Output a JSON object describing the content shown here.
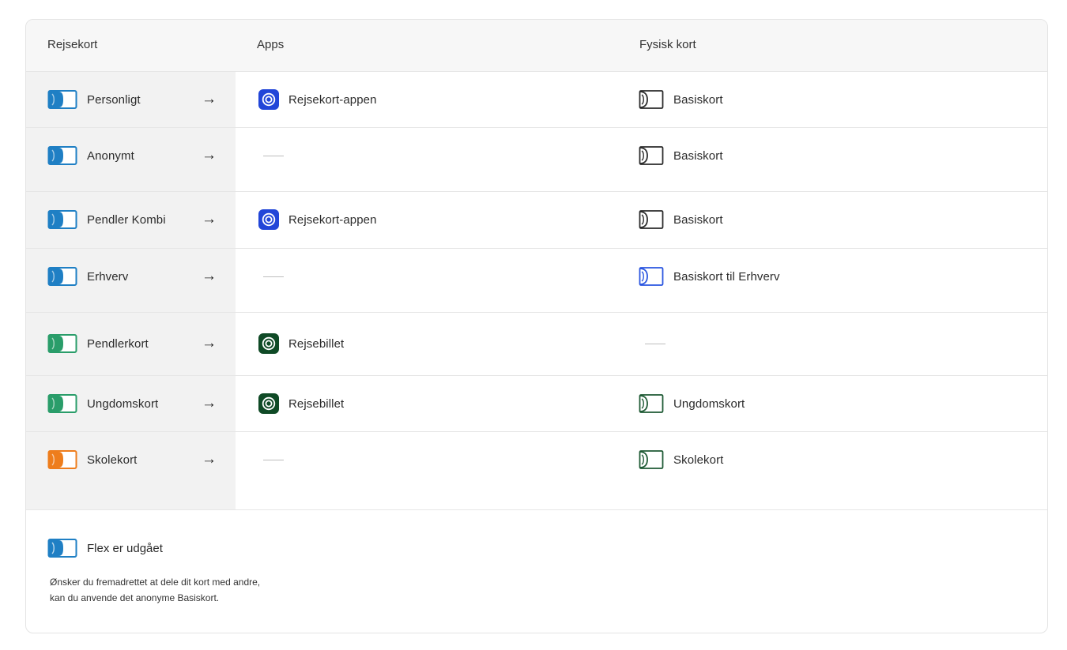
{
  "headers": {
    "col1": "Rejsekort",
    "col2": "Apps",
    "col3": "Fysisk kort"
  },
  "arrow": "→",
  "rows": [
    {
      "card": "Personligt",
      "card_color": "#1f7fc4",
      "app": "Rejsekort-appen",
      "app_color": "#2246d8",
      "physical": "Basiskort",
      "phys_color": "#2b2b2b"
    },
    {
      "card": "Anonymt",
      "card_color": "#1f7fc4",
      "app": "",
      "app_color": "",
      "physical": "Basiskort",
      "phys_color": "#2b2b2b"
    },
    {
      "card": "Pendler Kombi",
      "card_color": "#1f7fc4",
      "app": "Rejsekort-appen",
      "app_color": "#2246d8",
      "physical": "Basiskort",
      "phys_color": "#2b2b2b"
    },
    {
      "card": "Erhverv",
      "card_color": "#1f7fc4",
      "app": "",
      "app_color": "",
      "physical": "Basiskort til Erhverv",
      "phys_color": "#2a55e0"
    },
    {
      "card": "Pendlerkort",
      "card_color": "#2a9d6a",
      "app": "Rejsebillet",
      "app_color": "#0f4a26",
      "physical": "",
      "phys_color": ""
    },
    {
      "card": "Ungdomskort",
      "card_color": "#2a9d6a",
      "app": "Rejsebillet",
      "app_color": "#0f4a26",
      "physical": "Ungdomskort",
      "phys_color": "#1e5a34"
    },
    {
      "card": "Skolekort",
      "card_color": "#ee7d1c",
      "app": "",
      "app_color": "",
      "physical": "Skolekort",
      "phys_color": "#1e5a34"
    }
  ],
  "footer": {
    "flex_label": "Flex er udgået",
    "note_line1": "Ønsker du fremadrettet at dele dit kort med andre,",
    "note_line2": "kan du anvende det anonyme Basiskort."
  },
  "icons": {
    "card": "card-icon",
    "app": "app-target-icon",
    "physical": "physical-card-icon",
    "arrow": "arrow-right-icon"
  }
}
